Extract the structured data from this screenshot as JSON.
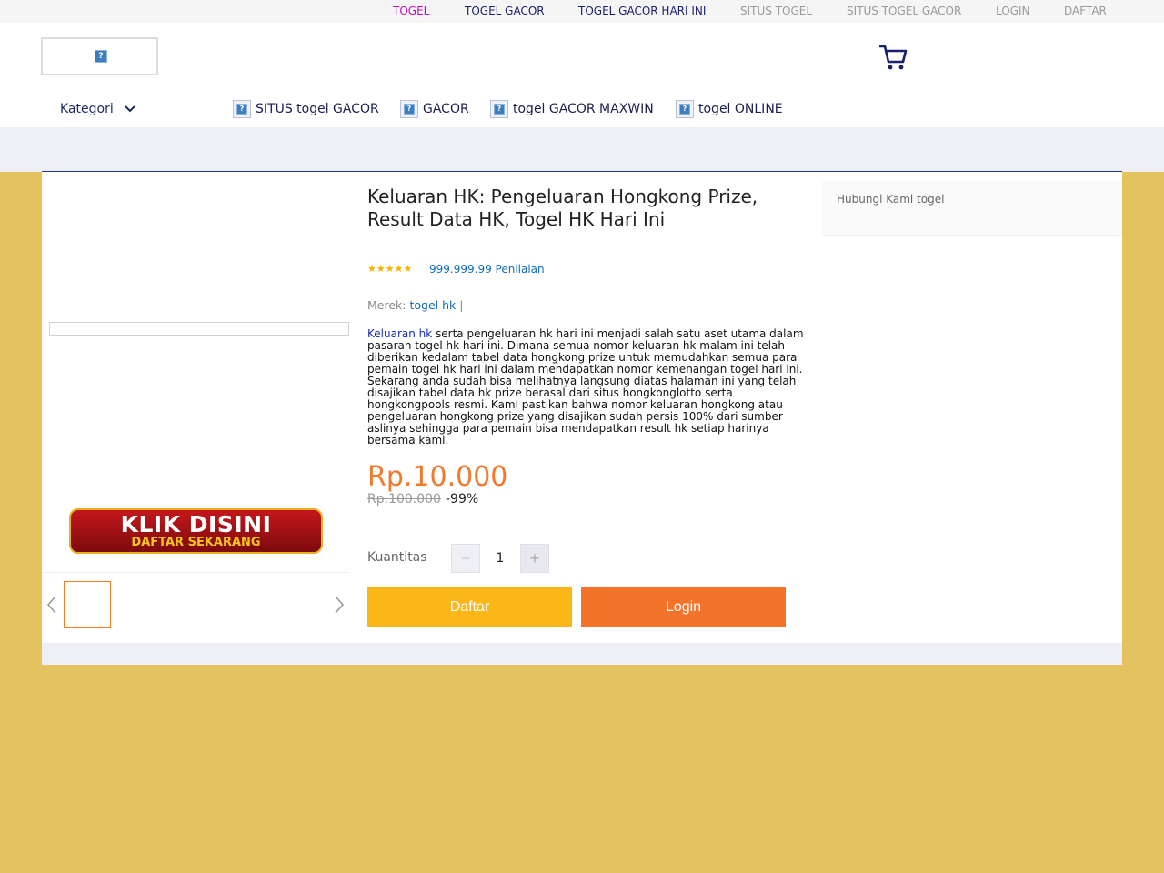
{
  "topnav": {
    "items": [
      {
        "label": "TOGEL",
        "color": "#c40fbd"
      },
      {
        "label": "TOGEL GACOR",
        "color": "#1a1f6e"
      },
      {
        "label": "TOGEL GACOR HARI INI",
        "color": "#1a1f6e"
      },
      {
        "label": "SITUS TOGEL",
        "color": "#999999"
      },
      {
        "label": "SITUS TOGEL GACOR",
        "color": "#999999"
      },
      {
        "label": "LOGIN",
        "color": "#999999"
      },
      {
        "label": "DAFTAR",
        "color": "#999999"
      }
    ]
  },
  "header": {
    "logo_icon": "broken-image-icon",
    "cart_icon": "cart-icon",
    "kategori_label": "Kategori",
    "categories": [
      {
        "label": "SITUS togel GACOR",
        "icon": "broken-image-icon"
      },
      {
        "label": "GACOR",
        "icon": "broken-image-icon"
      },
      {
        "label": "togel GACOR MAXWIN",
        "icon": "broken-image-icon"
      },
      {
        "label": "togel ONLINE",
        "icon": "broken-image-icon"
      }
    ]
  },
  "gallery": {
    "banner_line1": "KLIK DISINI",
    "banner_line2": "DAFTAR SEKARANG"
  },
  "product": {
    "title": "Keluaran HK: Pengeluaran Hongkong Prize, Result Data HK, Togel HK Hari Ini",
    "stars": "★★★★★",
    "rating_count": "999.999.99 Penilaian",
    "brand_label": "Merek:",
    "brand_value": "togel hk",
    "brand_sep": "|",
    "description_lead": "Keluaran hk",
    "description_rest": " serta pengeluaran hk hari ini menjadi salah satu aset utama dalam pasaran togel hk hari ini. Dimana semua nomor keluaran hk malam ini telah diberikan kedalam tabel data hongkong prize untuk memudahkan semua para pemain togel hk hari ini dalam mendapatkan nomor kemenangan togel hari ini. Sekarang anda sudah bisa melihatnya langsung diatas halaman ini yang telah disajikan tabel data hk prize berasal dari situs hongkonglotto serta hongkongpools resmi. Kami pastikan bahwa nomor keluaran hongkong atau pengeluaran hongkong prize yang disajikan sudah persis 100% dari sumber aslinya sehingga para pemain bisa mendapatkan result hk setiap harinya bersama kami.",
    "price": "Rp.10.000",
    "old_price": "Rp.100.000",
    "discount": "-99%",
    "quantity_label": "Kuantitas",
    "quantity_minus": "−",
    "quantity_value": "1",
    "quantity_plus": "+",
    "daftar_label": "Daftar",
    "login_label": "Login"
  },
  "sidebar": {
    "contact_label": "Hubungi Kami togel"
  },
  "colors": {
    "page_bg": "#e2c35f",
    "accent_orange": "#f4732a",
    "accent_yellow": "#fbb617",
    "link_blue": "#0f6cbd"
  }
}
